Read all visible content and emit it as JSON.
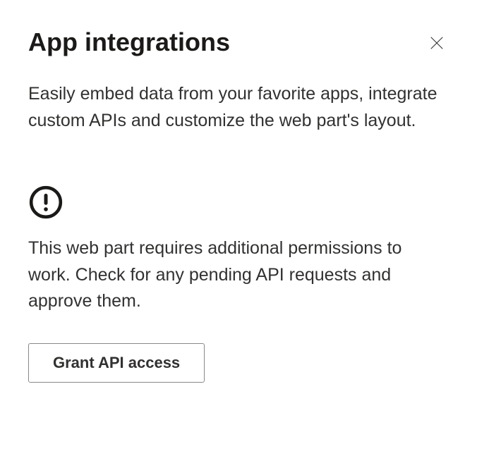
{
  "panel": {
    "title": "App integrations",
    "description": "Easily embed data from your favorite apps, integrate custom APIs and customize the web part's layout.",
    "warning_message": "This web part requires additional permissions to work. Check for any pending API requests and approve them.",
    "grant_button_label": "Grant API access"
  }
}
